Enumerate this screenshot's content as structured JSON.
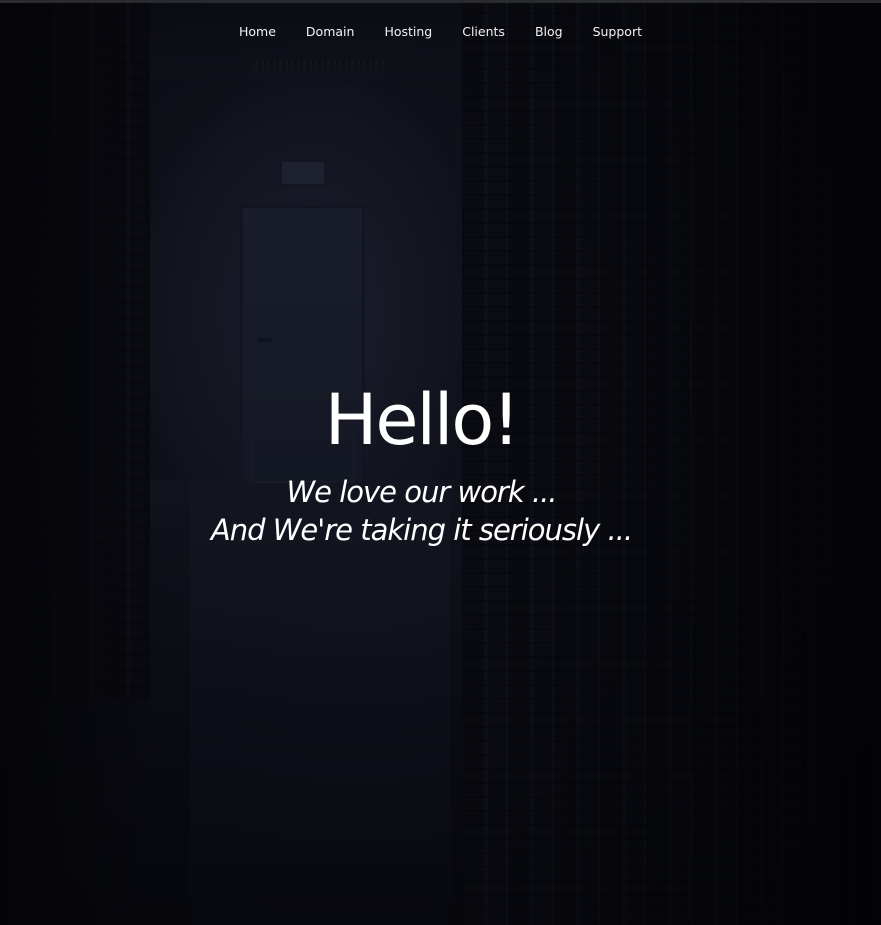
{
  "nav": {
    "items": [
      {
        "label": "Home"
      },
      {
        "label": "Domain"
      },
      {
        "label": "Hosting"
      },
      {
        "label": "Clients"
      },
      {
        "label": "Blog"
      },
      {
        "label": "Support"
      }
    ]
  },
  "hero": {
    "title": "Hello!",
    "tagline_line1": "We love our work ...",
    "tagline_line2": "And We're taking it seriously ..."
  },
  "colors": {
    "background": "#0d0f17",
    "text": "#ffffff"
  }
}
